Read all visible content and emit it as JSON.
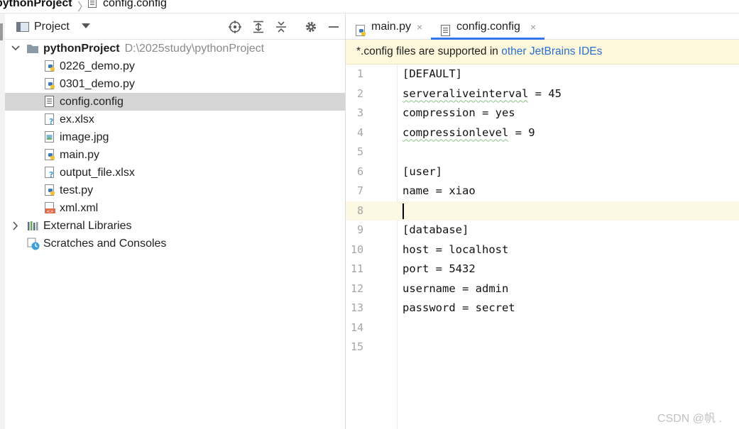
{
  "breadcrumb": {
    "project": "pythonProject",
    "separator": "〉",
    "file": "config.config"
  },
  "project_panel": {
    "title": "Project",
    "root": {
      "name": "pythonProject",
      "path": "D:\\2025study\\pythonProject"
    },
    "files": [
      {
        "name": "0226_demo.py",
        "icon": "python-file-icon"
      },
      {
        "name": "0301_demo.py",
        "icon": "python-file-icon"
      },
      {
        "name": "config.config",
        "icon": "text-file-icon",
        "selected": true
      },
      {
        "name": "ex.xlsx",
        "icon": "unknown-file-icon"
      },
      {
        "name": "image.jpg",
        "icon": "image-file-icon"
      },
      {
        "name": "main.py",
        "icon": "python-file-icon"
      },
      {
        "name": "output_file.xlsx",
        "icon": "unknown-file-icon"
      },
      {
        "name": "test.py",
        "icon": "python-file-icon"
      },
      {
        "name": "xml.xml",
        "icon": "xml-file-icon"
      }
    ],
    "external_libraries": "External Libraries",
    "scratches": "Scratches and Consoles"
  },
  "tabs": [
    {
      "label": "main.py",
      "close": "×",
      "active": false
    },
    {
      "label": "config.config",
      "close": "×",
      "active": true
    }
  ],
  "notice": {
    "text": "*.config files are supported in ",
    "link": "other JetBrains IDEs"
  },
  "code": {
    "line_numbers": [
      "1",
      "2",
      "3",
      "4",
      "5",
      "6",
      "7",
      "8",
      "9",
      "10",
      "11",
      "12",
      "13",
      "14",
      "15"
    ],
    "lines": [
      "[DEFAULT]",
      "serveraliveinterval = 45",
      "compression = yes",
      "compressionlevel = 9",
      "",
      "[user]",
      "name = xiao",
      "",
      "[database]",
      "host = localhost",
      "port = 5432",
      "username = admin",
      "password = secret",
      "",
      ""
    ],
    "current_line": 8
  },
  "watermark": "CSDN @帆 .",
  "colors": {
    "accent": "#3574f0",
    "selection": "#d5d5d5",
    "notice_bg": "#fdf7dc",
    "link": "#2a6fce"
  }
}
